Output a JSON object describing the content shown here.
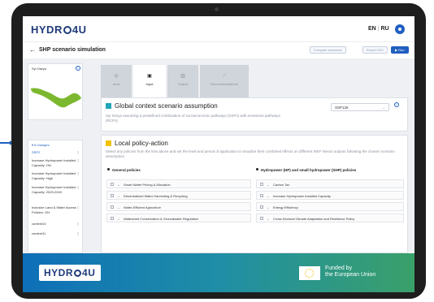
{
  "header": {
    "logo_left": "HYDR",
    "logo_right": "4U",
    "lang_en": "EN",
    "lang_ru": "RU"
  },
  "titlebar": {
    "title": "SHP scenario simulation",
    "btn_compare": "Compare scenarios",
    "btn_export": "Export CSV",
    "btn_run": "Run"
  },
  "sidebar": {
    "map_title": "Syr Darya",
    "changes_head": "8 changes",
    "items": [
      {
        "label": "SSP2",
        "active": true
      },
      {
        "label": "Increase Hydropower Installed Capacity: ON"
      },
      {
        "label": "Increase Hydropower Installed Capacity: High"
      },
      {
        "label": "Increase Hydropower Installed Capacity: 2025-2040"
      },
      {
        "label": "Inclusive Land & Water Access Policies: ON"
      },
      {
        "label": "content10"
      },
      {
        "label": "content11"
      }
    ]
  },
  "tabs": [
    {
      "label": "Area",
      "icon": "◎"
    },
    {
      "label": "Input",
      "icon": "▣",
      "active": true
    },
    {
      "label": "Output",
      "icon": "▥"
    },
    {
      "label": "Recommendations",
      "icon": "⟋"
    }
  ],
  "global": {
    "title": "Global context scenario assumption",
    "desc": "Syr Darya assuming a predefined combination of socioeconomic pathways (SSPs) with emissions pathways (RCPs).",
    "select_value": "SSP126",
    "accent": "#1fa6b8"
  },
  "local": {
    "title": "Local policy-action",
    "desc": "Select any policies from the lists above and set the level and period of application to visualize their combined effects on different WEF Nexus outputs following the chosen scenario assumption.",
    "accent": "#f2c200",
    "general_head": "General policies",
    "hydro_head": "Hydropower (HP) and small hydropower (SHP) policies",
    "general": [
      "Smart Water Pricing & Allocation",
      "Decentralized Water Harvesting & Recycling",
      "Water-Efficient Agriculture",
      "Watershed Conservation & Groundwater Regulation"
    ],
    "hydro": [
      "Carbon Tax",
      "Increase Hydropower Installed Capacity",
      "Energy Efficiency",
      "Cross-Sectoral Climate Adaptation and Resilience Policy"
    ]
  },
  "footer": {
    "logo_left": "HYDR",
    "logo_right": "4U",
    "funded_line1": "Funded by",
    "funded_line2": "the European Union"
  }
}
